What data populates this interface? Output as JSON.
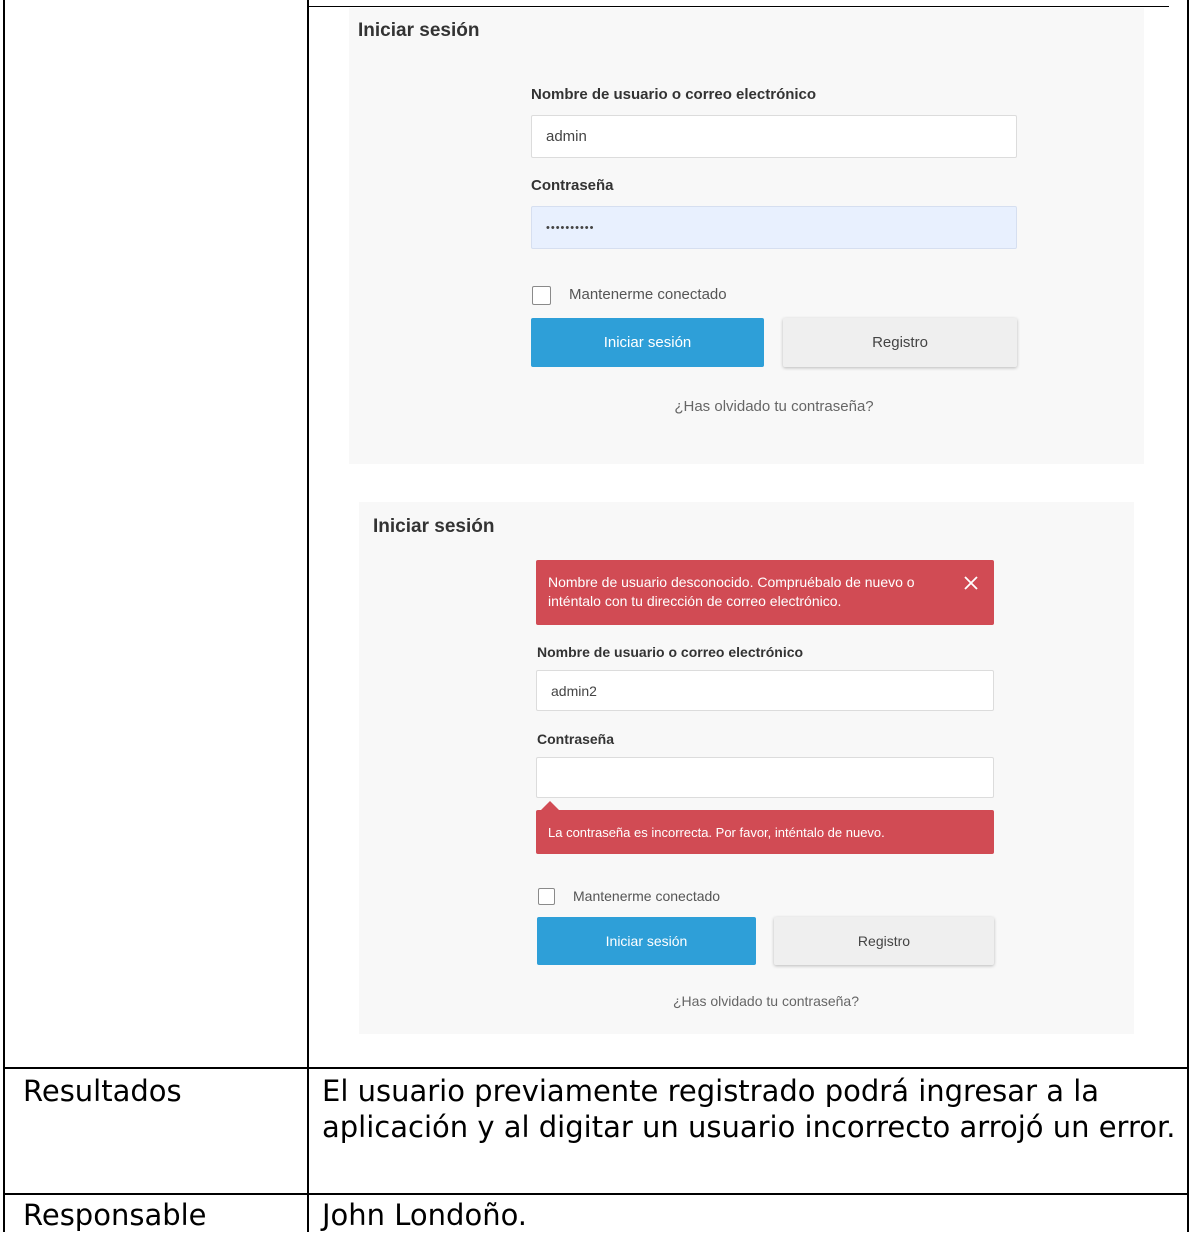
{
  "screenshot_1": {
    "title": "Iniciar sesión",
    "username_label": "Nombre de usuario o correo electrónico",
    "username_value": "admin",
    "password_label": "Contraseña",
    "password_value": "••••••••••",
    "remember_label": "Mantenerme conectado",
    "login_button": "Iniciar sesión",
    "register_button": "Registro",
    "forgot_link": "¿Has olvidado tu contraseña?"
  },
  "screenshot_2": {
    "title": "Iniciar sesión",
    "error_alert": "Nombre de usuario desconocido. Compruébalo de nuevo o inténtalo con tu dirección de correo electrónico.",
    "username_label": "Nombre de usuario o correo electrónico",
    "username_value": "admin2",
    "password_label": "Contraseña",
    "password_value": "",
    "password_error": "La contraseña es incorrecta. Por favor, inténtalo de nuevo.",
    "remember_label": "Mantenerme conectado",
    "login_button": "Iniciar sesión",
    "register_button": "Registro",
    "forgot_link": "¿Has olvidado tu contraseña?"
  },
  "table": {
    "rows": [
      {
        "label": "Resultados",
        "value": "El usuario previamente registrado podrá ingresar a la aplicación y al digitar un usuario incorrecto arrojó un error."
      },
      {
        "label": "Responsable",
        "value": "John Londoño."
      }
    ]
  },
  "colors": {
    "primary_button": "#2e9fd8",
    "error": "#d14b54",
    "autofill": "#e8f0fe",
    "panel": "#f8f8f8"
  }
}
